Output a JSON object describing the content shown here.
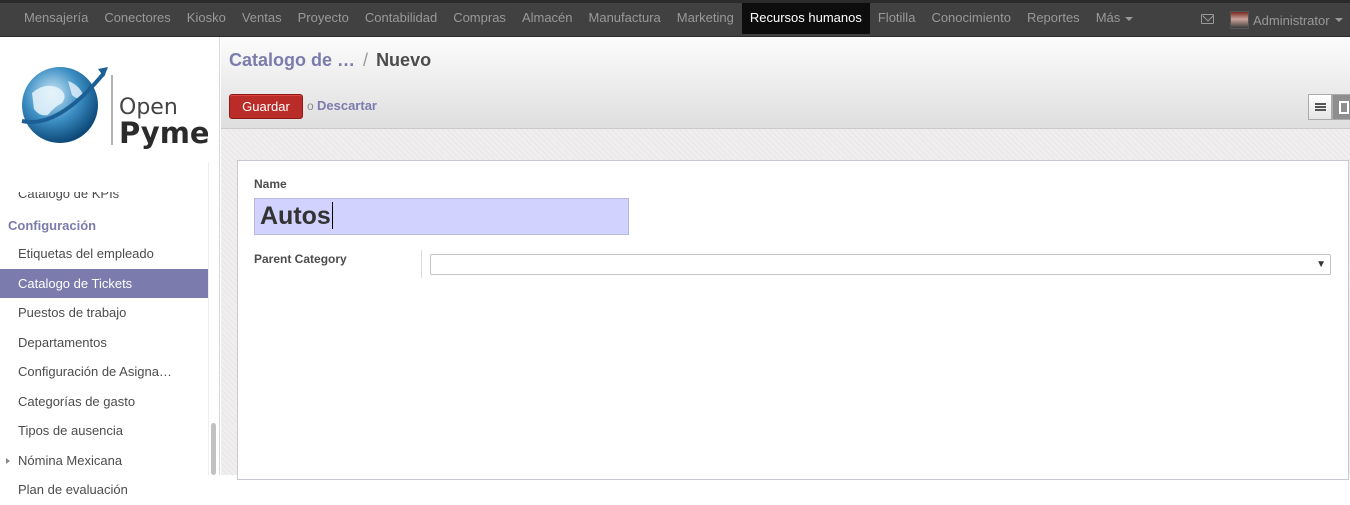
{
  "topbar": {
    "menu": [
      "Mensajería",
      "Conectores",
      "Kiosko",
      "Ventas",
      "Proyecto",
      "Contabilidad",
      "Compras",
      "Almacén",
      "Manufactura",
      "Marketing",
      "Recursos humanos",
      "Flotilla",
      "Conocimiento",
      "Reportes",
      "Más"
    ],
    "active_menu": "Recursos humanos",
    "user": "Administrator"
  },
  "logo": {
    "line1": "Open",
    "line2": "Pyme"
  },
  "sidebar": {
    "items_top": [
      {
        "label": "Catalogo de KPIs"
      }
    ],
    "section": "Configuración",
    "items": [
      {
        "label": "Etiquetas del empleado"
      },
      {
        "label": "Catalogo de Tickets"
      },
      {
        "label": "Puestos de trabajo"
      },
      {
        "label": "Departamentos"
      },
      {
        "label": "Configuración de Asigna…"
      },
      {
        "label": "Categorías de gasto"
      },
      {
        "label": "Tipos de ausencia"
      },
      {
        "label": "Nómina Mexicana"
      },
      {
        "label": "Plan de evaluación"
      }
    ],
    "active_item": "Catalogo de Tickets"
  },
  "breadcrumb": {
    "parent": "Catalogo de …",
    "separator": "/",
    "current": "Nuevo"
  },
  "buttons": {
    "save": "Guardar",
    "or": "o",
    "discard": "Descartar"
  },
  "form": {
    "name_label": "Name",
    "name_value": "Autos",
    "parent_label": "Parent Category",
    "parent_value": ""
  },
  "colors": {
    "accent": "#7c7bad",
    "save": "#b92c28",
    "topbar": "#414141",
    "name_field": "#d2d2ff"
  }
}
